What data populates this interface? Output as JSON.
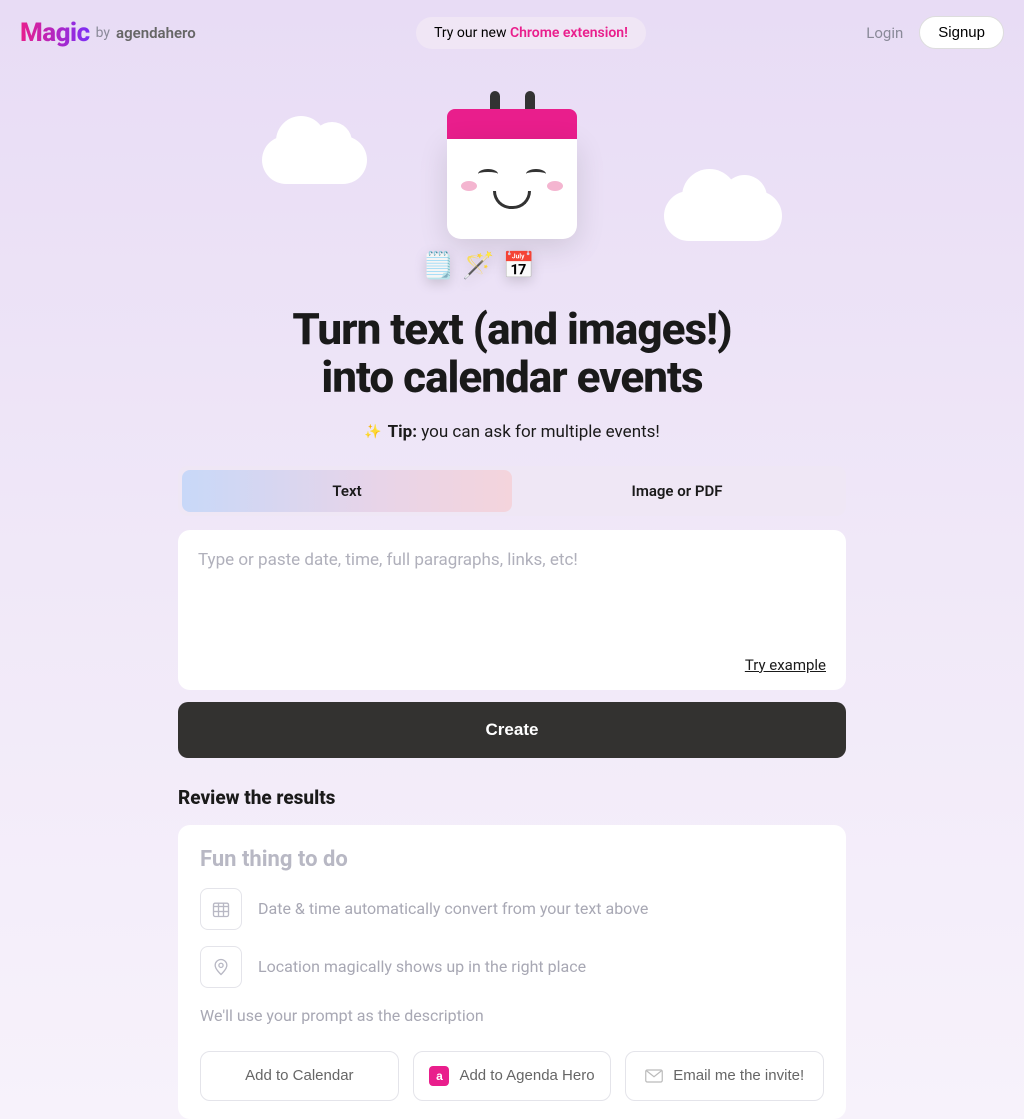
{
  "header": {
    "logo_magic": "Magic",
    "logo_by": "by",
    "logo_brand": "agendahero",
    "promo_prefix": "Try our new ",
    "promo_highlight": "Chrome extension!",
    "login": "Login",
    "signup": "Signup"
  },
  "hero": {
    "headline_l1": "Turn text (and images!)",
    "headline_l2": "into calendar events",
    "tip_label": "Tip:",
    "tip_text": " you can ask for multiple events!"
  },
  "tabs": {
    "text": "Text",
    "image": "Image or PDF"
  },
  "input": {
    "placeholder": "Type or paste date, time, full paragraphs, links, etc!",
    "try_example": "Try example"
  },
  "create_label": "Create",
  "review": {
    "title": "Review the results",
    "heading": "Fun thing to do",
    "date_text": "Date & time automatically convert from your text above",
    "location_text": "Location magically shows up in the right place",
    "desc_text": "We'll use your prompt as the description"
  },
  "actions": {
    "add_calendar": "Add to Calendar",
    "add_agenda": "Add to Agenda Hero",
    "email_invite": "Email me the invite!"
  }
}
